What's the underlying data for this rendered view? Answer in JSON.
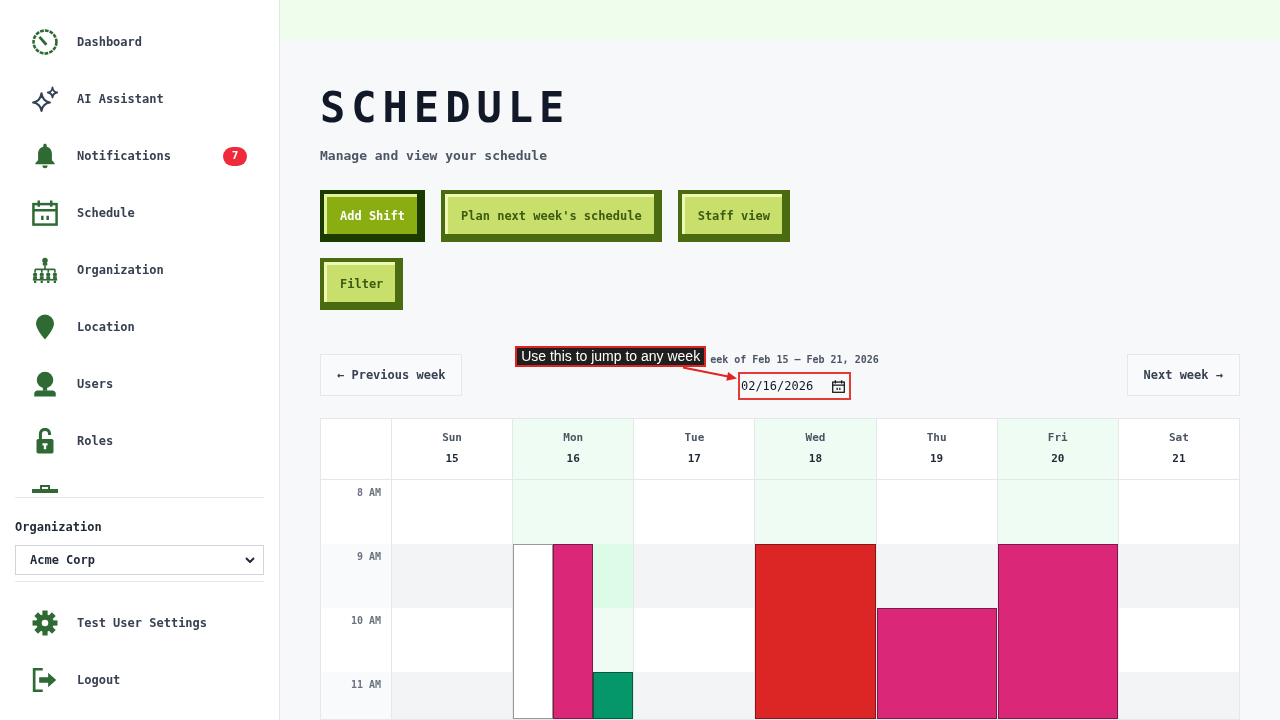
{
  "sidebar": {
    "nav_items": [
      {
        "label": "Dashboard"
      },
      {
        "label": "AI Assistant"
      },
      {
        "label": "Notifications",
        "badge": "7"
      },
      {
        "label": "Schedule"
      },
      {
        "label": "Organization"
      },
      {
        "label": "Location"
      },
      {
        "label": "Users"
      },
      {
        "label": "Roles"
      }
    ],
    "organization_picker": {
      "label": "Organization",
      "value": "Acme Corp"
    },
    "footer_items": [
      {
        "label": "Test User Settings"
      },
      {
        "label": "Logout"
      }
    ]
  },
  "header": {
    "title": "SCHEDULE",
    "subtitle": "Manage and view your schedule"
  },
  "actions": [
    {
      "label": "Add Shift",
      "kind": "primary"
    },
    {
      "label": "Plan next week's schedule",
      "kind": "secondary"
    },
    {
      "label": "Staff view",
      "kind": "secondary"
    },
    {
      "label": "Filter",
      "kind": "secondary"
    }
  ],
  "week_navigation": {
    "previous": "← Previous week",
    "week_label": "eek of Feb 15 – Feb 21, 2026",
    "date": "02/16/2026",
    "tooltip": "Use this to jump to any week",
    "next": "Next week →"
  },
  "calendar": {
    "days": [
      {
        "name": "Sun",
        "date": "15",
        "highlighted": false
      },
      {
        "name": "Mon",
        "date": "16",
        "highlighted": true
      },
      {
        "name": "Tue",
        "date": "17",
        "highlighted": false
      },
      {
        "name": "Wed",
        "date": "18",
        "highlighted": true
      },
      {
        "name": "Thu",
        "date": "19",
        "highlighted": false
      },
      {
        "name": "Fri",
        "date": "20",
        "highlighted": true
      },
      {
        "name": "Sat",
        "date": "21",
        "highlighted": false
      }
    ],
    "rows": [
      {
        "time": "8 AM"
      },
      {
        "time": "9 AM",
        "cells": [
          {},
          {
            "shifts": [
              {
                "color": "#ffffff"
              },
              {
                "color": "#db2777"
              }
            ]
          },
          {},
          {
            "shifts": [
              {
                "color": "#dc2626"
              }
            ]
          },
          {},
          {
            "shifts": [
              {
                "color": "#db2777"
              }
            ]
          },
          {}
        ]
      },
      {
        "time": "10 AM",
        "cells": [
          {},
          {},
          {},
          {},
          {
            "shifts": [
              {
                "color": "#db2777"
              }
            ]
          },
          {},
          {}
        ]
      },
      {
        "time": "11 AM",
        "cells": [
          {},
          {
            "shifts": [
              {
                "color": "#059669"
              }
            ]
          },
          {},
          {},
          {},
          {},
          {}
        ]
      }
    ]
  }
}
